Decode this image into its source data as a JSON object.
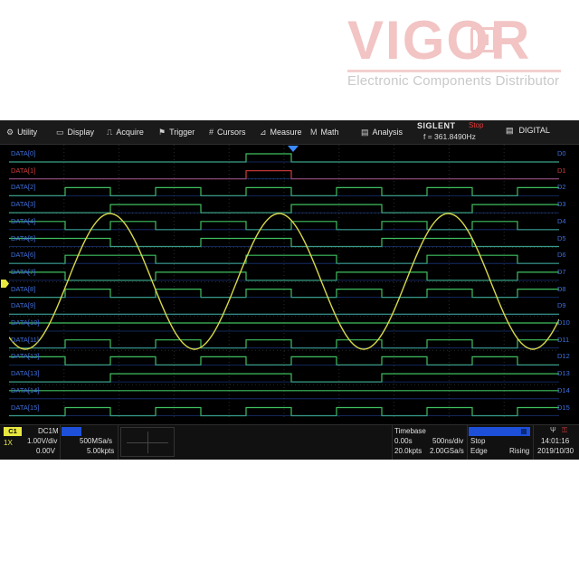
{
  "watermark": {
    "name": "VIGOR",
    "tagline": "Electronic Components Distributor"
  },
  "menubar": {
    "items": [
      {
        "label": "Utility",
        "icon": "gear-icon"
      },
      {
        "label": "Display",
        "icon": "monitor-icon"
      },
      {
        "label": "Acquire",
        "icon": "waveform-icon"
      },
      {
        "label": "Trigger",
        "icon": "flag-icon"
      },
      {
        "label": "Cursors",
        "icon": "cursor-grid-icon"
      },
      {
        "label": "Measure",
        "icon": "measure-icon"
      },
      {
        "label": "Math",
        "icon": "math-icon"
      },
      {
        "label": "Analysis",
        "icon": "analysis-icon"
      }
    ],
    "brand": "SIGLENT",
    "run_status": "Stop",
    "frequency": "f = 361.8490Hz",
    "digital_label": "DIGITAL"
  },
  "channels": {
    "digital": [
      {
        "name": "DATA[0]",
        "right": "D0"
      },
      {
        "name": "DATA[1]",
        "right": "D1"
      },
      {
        "name": "DATA[2]",
        "right": "D2"
      },
      {
        "name": "DATA[3]",
        "right": "D3"
      },
      {
        "name": "DATA[4]",
        "right": "D4"
      },
      {
        "name": "DATA[5]",
        "right": "D5"
      },
      {
        "name": "DATA[6]",
        "right": "D6"
      },
      {
        "name": "DATA[7]",
        "right": "D7"
      },
      {
        "name": "DATA[8]",
        "right": "D8"
      },
      {
        "name": "DATA[9]",
        "right": "D9"
      },
      {
        "name": "DATA[10]",
        "right": "D10"
      },
      {
        "name": "DATA[11]",
        "right": "D11"
      },
      {
        "name": "DATA[12]",
        "right": "D12"
      },
      {
        "name": "DATA[13]",
        "right": "D13"
      },
      {
        "name": "DATA[14]",
        "right": "D14"
      },
      {
        "name": "DATA[15]",
        "right": "D15"
      }
    ],
    "colors": {
      "digital_high": "#3fbf5f",
      "digital_low": "#2f5fd8",
      "highlight": "#d23b3b",
      "analog": "#d8d84a",
      "label": "#3f6fdc"
    }
  },
  "bottombar": {
    "ch1": {
      "tag": "C1",
      "coupling": "DC1M",
      "probe": "1X",
      "scale": "1.00V/div",
      "offset": "0.00V"
    },
    "digital": {
      "rate": "500MSa/s",
      "points": "5.00kpts"
    },
    "timebase": {
      "title": "Timebase",
      "delay": "0.00s",
      "scale": "500ns/div",
      "points": "20.0kpts",
      "rate": "2.00GSa/s"
    },
    "trigger": {
      "state": "Stop",
      "type": "Edge",
      "slope": "Rising"
    },
    "clock": {
      "time": "14:01:16",
      "date": "2019/10/30"
    }
  }
}
